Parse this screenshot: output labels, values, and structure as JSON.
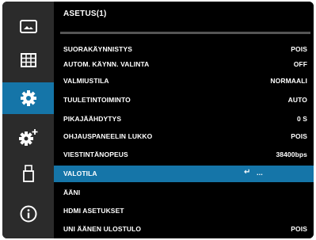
{
  "sidebar": {
    "items": [
      {
        "icon": "picture-icon"
      },
      {
        "icon": "grid-icon"
      },
      {
        "icon": "gear-icon",
        "active": true
      },
      {
        "icon": "gear-plus-icon"
      },
      {
        "icon": "usb-icon"
      },
      {
        "icon": "info-icon"
      }
    ]
  },
  "menu": {
    "title": "ASETUS(1)",
    "rows": [
      {
        "label": "SUORAKÄYNNISTYS",
        "value": "POIS"
      },
      {
        "label": "AUTOM. KÄYNN. VALINTA",
        "value": "OFF"
      },
      {
        "label": "VALMIUSTILA",
        "value": "NORMAALI"
      },
      {
        "label": "TUULETINTOIMINTO",
        "value": "AUTO"
      },
      {
        "label": "PIKAJÄÄHDYTYS",
        "value": "0 S"
      },
      {
        "label": "OHJAUSPANEELIN LUKKO",
        "value": "POIS"
      },
      {
        "label": "VIESTINTÄNOPEUS",
        "value": "38400bps"
      },
      {
        "label": "VALOTILA",
        "enter_glyph": "↵",
        "value": "..."
      },
      {
        "label": "ÄÄNI",
        "value": ""
      },
      {
        "label": "HDMI ASETUKSET",
        "value": ""
      },
      {
        "label": "UNI ÄÄNEN ULOSTULO",
        "value": "POIS"
      }
    ]
  },
  "colors": {
    "highlight": "#1575a8",
    "sidebar_bg": "#2b2b2b",
    "menu_bg": "#000000",
    "text": "#ffffff"
  }
}
